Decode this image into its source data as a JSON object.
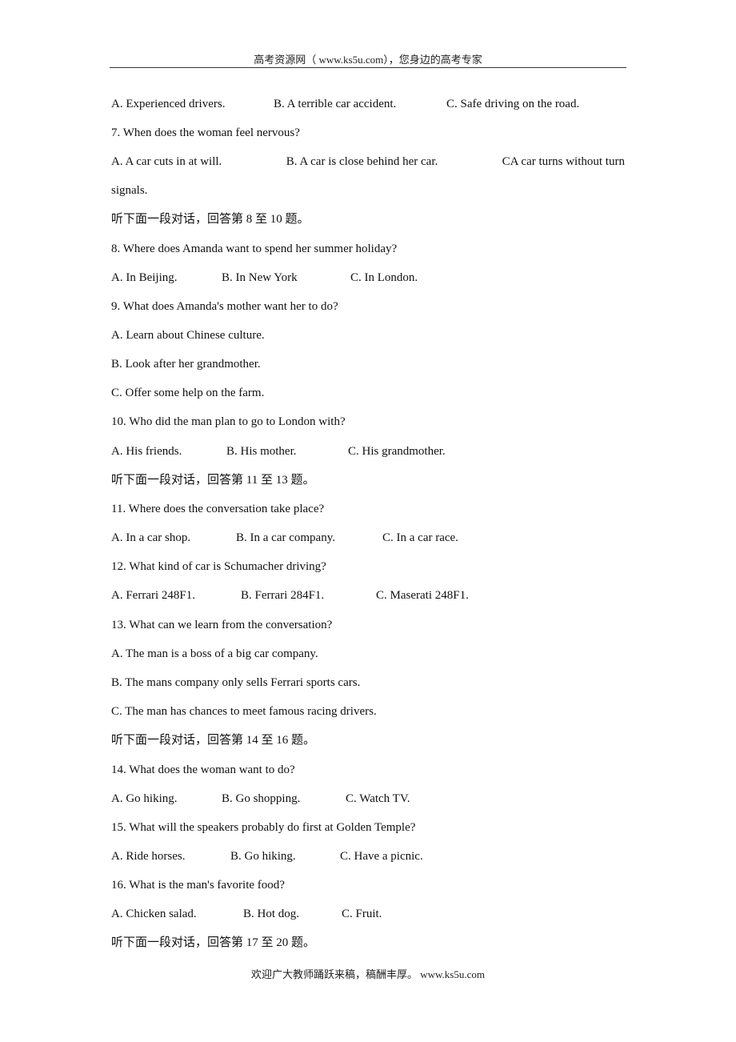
{
  "header": {
    "text": "高考资源网（ www.ks5u.com），您身边的高考专家"
  },
  "footer": {
    "text": "欢迎广大教师踊跃来稿，稿酬丰厚。 www.ks5u.com"
  },
  "q6_options": {
    "a": "A. Experienced drivers.",
    "b": "B. A terrible car accident.",
    "c": "C. Safe driving on the road."
  },
  "q7": {
    "question": "7. When does the woman feel nervous?",
    "a": "A. A car cuts in at will.",
    "b": "B. A car is close behind her car.",
    "c": "CA car turns without turn",
    "c_cont": "signals."
  },
  "section_8_10": "听下面一段对话，回答第 8 至 10 题。",
  "q8": {
    "question": "8. Where does Amanda want to spend her summer holiday?",
    "a": "A. In Beijing.",
    "b": "B. In New York",
    "c": "C. In London."
  },
  "q9": {
    "question": "9. What does Amanda's mother want her to do?",
    "a": "A. Learn about Chinese culture.",
    "b": "B. Look after her grandmother.",
    "c": "C. Offer some help on the farm."
  },
  "q10": {
    "question": "10. Who did the man plan to go to London with?",
    "a": "A. His friends.",
    "b": "B. His mother.",
    "c": "C. His grandmother."
  },
  "section_11_13": "听下面一段对话，回答第 11 至 13 题。",
  "q11": {
    "question": "11. Where does the conversation take place?",
    "a": "A. In a car shop.",
    "b": "B. In a car company.",
    "c": "C. In a car race."
  },
  "q12": {
    "question": "12. What kind of car is Schumacher driving?",
    "a": "A. Ferrari 248F1.",
    "b": "B. Ferrari 284F1.",
    "c": "C. Maserati 248F1."
  },
  "q13": {
    "question": "13. What can we learn from the conversation?",
    "a": "A. The man is a boss of a big car company.",
    "b": "B. The mans company only sells Ferrari sports cars.",
    "c": "C. The man has chances to meet famous racing drivers."
  },
  "section_14_16": "听下面一段对话，回答第 14 至 16 题。",
  "q14": {
    "question": "14. What does the woman want to do?",
    "a": "A. Go hiking.",
    "b": "B. Go shopping.",
    "c": "C. Watch TV."
  },
  "q15": {
    "question": "15. What will the speakers probably do first at Golden Temple?",
    "a": "A. Ride horses.",
    "b": "B. Go hiking.",
    "c": "C. Have a picnic."
  },
  "q16": {
    "question": "16. What is the man's favorite food?",
    "a": "A. Chicken salad.",
    "b": "B. Hot dog.",
    "c": "C. Fruit."
  },
  "section_17_20": "听下面一段对话，回答第 17 至 20 题。"
}
